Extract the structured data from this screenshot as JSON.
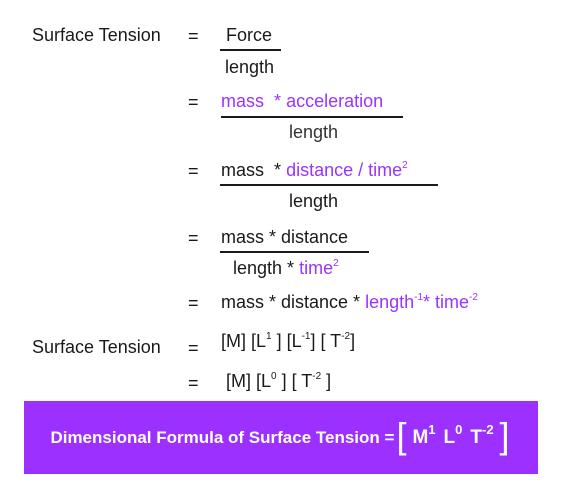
{
  "colors": {
    "accent_text": "#9933ff",
    "banner_bg": "#9b30ff",
    "banner_text": "#ffffff",
    "body_text": "#1a1a1a"
  },
  "derivation": {
    "lhs_label": "Surface Tension",
    "equals": "=",
    "step1": {
      "numerator": "Force",
      "denominator": "length"
    },
    "step2": {
      "numerator_a": "mass",
      "numerator_op": "*",
      "numerator_b": "acceleration",
      "denominator": "length"
    },
    "step3": {
      "numerator_a": "mass",
      "numerator_op": "*",
      "numerator_b": "distance / time",
      "numerator_b_exp": "2",
      "denominator": "length"
    },
    "step4": {
      "numerator": "mass * distance",
      "denominator_a": "length *",
      "denominator_b": "time",
      "denominator_b_exp": "2"
    },
    "step5": {
      "text_a": "mass * distance *",
      "text_b": "length",
      "text_b_exp": "-1",
      "text_c": "* time",
      "text_c_exp": "-2"
    },
    "step6": {
      "lhs_label": "Surface Tension",
      "m": "[M] [L",
      "l1_exp": "1",
      "mid": " ] [L",
      "l2_exp": "-1",
      "mid2": "] [ T",
      "t_exp": "-2",
      "end": "]"
    },
    "step7": {
      "m": "[M] [L",
      "l_exp": "0",
      "mid": " ] [ T",
      "t_exp": "-2",
      "end": " ]"
    }
  },
  "result_banner": {
    "label": "Dimensional Formula of Surface Tension =",
    "open_bracket": "[",
    "m": "M",
    "m_exp": "1",
    "l": "L",
    "l_exp": "0",
    "t": "T",
    "t_exp": "-2",
    "close_bracket": "]"
  }
}
